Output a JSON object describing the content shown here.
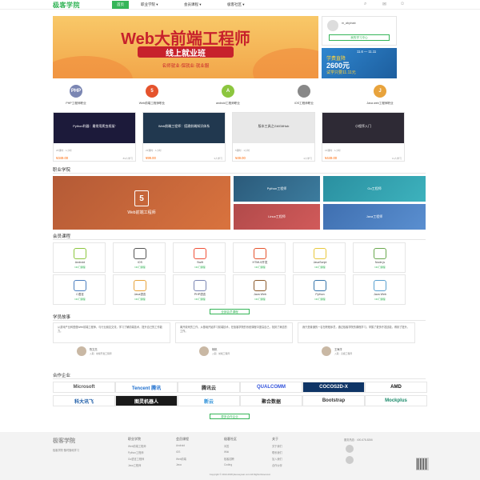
{
  "header": {
    "logo": "极客学院",
    "logo_sub": "jikexueyuan.com",
    "nav": [
      "首页",
      "职业学院",
      "会员课程",
      "极客社区"
    ],
    "user": "m_abyinab"
  },
  "banner": {
    "title": "Web大前端工程师",
    "subtitle": "线上就业班",
    "tagline": "名师就业·保就业·就业服"
  },
  "panel": {
    "username": "m_abyinab",
    "button": "我的学习中心"
  },
  "promo": {
    "dates": "11.6 — 11.11",
    "line1": "学费直降",
    "price": "2600元",
    "line2": "试学只要11.11元"
  },
  "categories": [
    {
      "label": "PHP工程师职业",
      "icon": "php-icon",
      "color": "#7b86b3",
      "text": "PHP"
    },
    {
      "label": "Web前端工程师职业",
      "icon": "html5-icon",
      "color": "#e5532d",
      "text": "5"
    },
    {
      "label": "android工程师职业",
      "icon": "android-icon",
      "color": "#8cc63f",
      "text": "A"
    },
    {
      "label": "iOS工程师职业",
      "icon": "apple-icon",
      "color": "#888888",
      "text": ""
    },
    {
      "label": "Java web工程师职业",
      "icon": "java-icon",
      "color": "#e8a33c",
      "text": "J"
    }
  ],
  "course_cards": [
    {
      "title": "Python利器：最常用爬虫框架“",
      "meta": "26课时 · 1小时",
      "price": "¥349.00",
      "students": "83人学习",
      "img": "#1c1a3a"
    },
    {
      "title": "Web前端工程师：搭建前端知识体系",
      "meta": "23课时 · 1小时",
      "price": "¥99.00",
      "students": "3人学习",
      "img": "#21384f"
    },
    {
      "title": "版本工具之Git/GitHub",
      "meta": "5课时 · 1小时",
      "price": "¥49.00",
      "students": "4人学习",
      "img": "#e8e8e8"
    },
    {
      "title": "小程序入门",
      "meta": "16课时 · 1小时",
      "price": "¥449.00",
      "students": "11人学习",
      "img": "#2e2a35"
    }
  ],
  "career": {
    "heading": "职业学院",
    "tiles": [
      "Web前端工程师",
      "Python工程师",
      "Go工程师",
      "Java工程师",
      "Linux工程师"
    ]
  },
  "member": {
    "heading": "会员课程",
    "courses": [
      {
        "title": "Android",
        "sub": "NN门课程",
        "color": "#8cc63f"
      },
      {
        "title": "iOS",
        "sub": "NN门课程",
        "color": "#555555"
      },
      {
        "title": "Swift",
        "sub": "NN门课程",
        "color": "#f05138"
      },
      {
        "title": "HTML5开发",
        "sub": "NN门课程",
        "color": "#e5532d"
      },
      {
        "title": "JavaScript",
        "sub": "NN门课程",
        "color": "#e8c83c"
      },
      {
        "title": "Node.js",
        "sub": "NN门课程",
        "color": "#6aa84f"
      },
      {
        "title": "C语言",
        "sub": "NN门课程",
        "color": "#4a7fc1"
      },
      {
        "title": "Java语言",
        "sub": "NN门课程",
        "color": "#e8a33c"
      },
      {
        "title": "PHP语言",
        "sub": "NN门课程",
        "color": "#7b86b3"
      },
      {
        "title": "Java Web",
        "sub": "NN门课程",
        "color": "#8b5a2b"
      },
      {
        "title": "Python",
        "sub": "NN门课程",
        "color": "#3776ab"
      },
      {
        "title": "Java Web",
        "sub": "NN门课程",
        "color": "#5aa0d0"
      }
    ],
    "more_button": "全部会员课程"
  },
  "stories": {
    "heading": "学员故事",
    "items": [
      {
        "text": "从游戏产业转型做Web前端工程师，与行业朋友交流，学习了解前端技术，提升自己的工作能力。",
        "name": "陈文亮",
        "role": "入职 · 前端开发工程师"
      },
      {
        "text": "离开原来的工作，从基础开始学习前端技术，在极客学院的系统课程中提高自己，找到了满意的工作。",
        "name": "杨帆",
        "role": "入职 · 前端工程师"
      },
      {
        "text": "我只是普通的一名在职程序员，通过极客学院的课程学习，掌握了更多开发技能，得到了提升。",
        "name": "王海洋",
        "role": "入职 · 高级工程师"
      }
    ]
  },
  "partners": {
    "heading": "合作企业",
    "logos": [
      {
        "name": "Microsoft",
        "color": "#555555"
      },
      {
        "name": "Tencent 腾讯",
        "color": "#1e6fce"
      },
      {
        "name": "腾讯云",
        "color": "#333333"
      },
      {
        "name": "QUALCOMM",
        "color": "#3253dc"
      },
      {
        "name": "COCOS2D-X",
        "color": "#ffffff"
      },
      {
        "name": "AMD",
        "color": "#111111"
      },
      {
        "name": "科大讯飞",
        "color": "#1a5aa6"
      },
      {
        "name": "图灵机器人",
        "color": "#ffffff"
      },
      {
        "name": "新云",
        "color": "#2a8fd8"
      },
      {
        "name": "聚合数据",
        "color": "#333333"
      },
      {
        "name": "Bootstrap",
        "color": "#333333"
      },
      {
        "name": "Mockplus",
        "color": "#1a8a6a"
      }
    ],
    "more_button": "更多合作企业"
  },
  "footer": {
    "logo": "极客学院",
    "slogan": "极客学院·随时随地学习",
    "cols": [
      {
        "title": "职业学院",
        "links": [
          "Web前端工程师",
          "Python工程师",
          "Go语言工程师",
          "Java工程师"
        ]
      },
      {
        "title": "会员课程",
        "links": [
          "Android",
          "iOS",
          "Web前端",
          "Java"
        ]
      },
      {
        "title": "极客社区",
        "links": [
          "问答",
          "Wiki",
          "极客招聘",
          "Coding"
        ]
      },
      {
        "title": "关于",
        "links": [
          "关于我们",
          "联系我们",
          "加入我们",
          "合作伙伴"
        ]
      }
    ],
    "contact": "服务热线：400-678-8266",
    "copyright": "Copyright © 2013-2018 jikexueyuan.com All Rights Reserved."
  }
}
